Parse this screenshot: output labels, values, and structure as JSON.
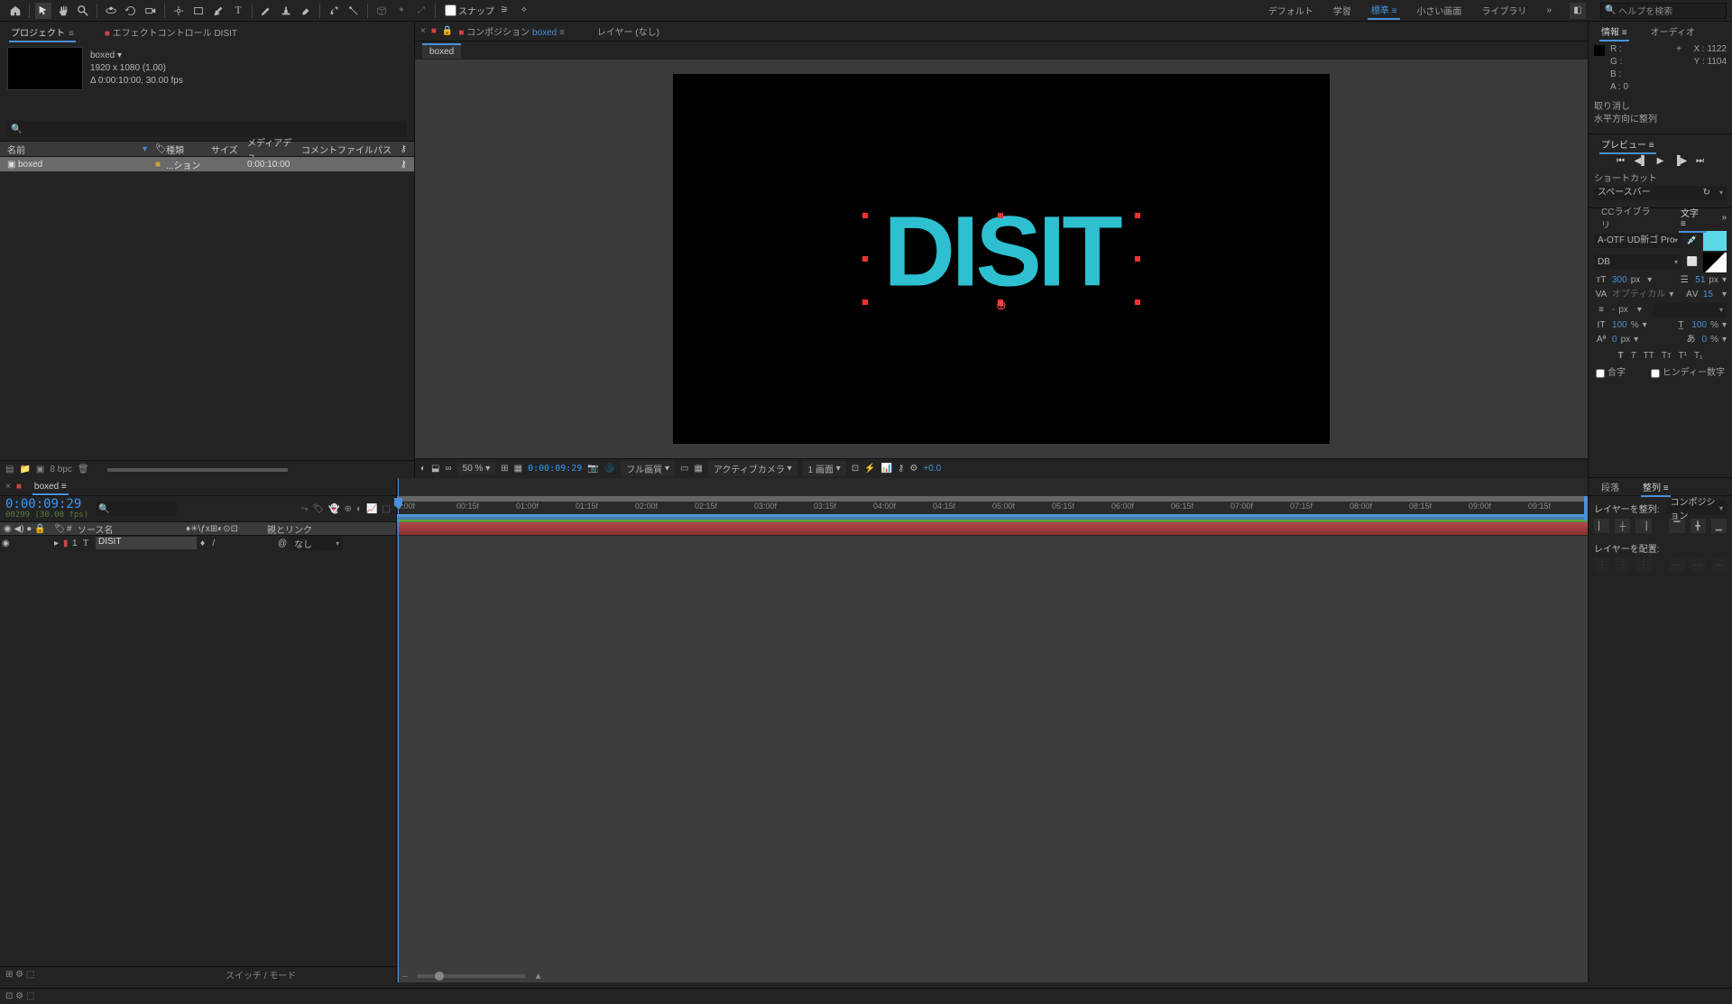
{
  "toolbar": {
    "snap_label": "スナップ",
    "workspace_items": [
      "デフォルト",
      "学習",
      "標準",
      "小さい画面",
      "ライブラリ"
    ],
    "workspace_active": 2,
    "search_placeholder": "ヘルプを検索"
  },
  "project_panel": {
    "tab_project": "プロジェクト",
    "tab_effect": "エフェクトコントロール DISIT",
    "item_name": "boxed",
    "res": "1920 x 1080 (1.00)",
    "dur": "Δ 0:00:10:00, 30.00 fps",
    "cols": {
      "name": "名前",
      "type": "種類",
      "size": "サイズ",
      "media": "メディアデュ..",
      "comment": "コメント",
      "file": "ファイルパス"
    },
    "row": {
      "name": "boxed",
      "type": "...ション",
      "media": "0:00:10:00"
    },
    "bpc": "8 bpc"
  },
  "viewer": {
    "lock": "🔒",
    "comp_label": "コンポジション",
    "comp_name": "boxed",
    "layer_tab": "レイヤー (なし)",
    "subtab": "boxed",
    "text": "DISIT",
    "footer": {
      "zoom": "50 %",
      "tc": "0:00:09:29",
      "quality": "フル画質",
      "camera": "アクティブカメラ",
      "views": "1 画面",
      "exp": "+0.0"
    }
  },
  "info_panel": {
    "tab_info": "情報",
    "tab_audio": "オーディオ",
    "r": "R :",
    "g": "G :",
    "b": "B :",
    "a": "A :  0",
    "x": "X : 1122",
    "y": "Y : 1104",
    "undo": "取り消し",
    "align_msg": "水平方向に整列"
  },
  "preview_panel": {
    "title": "プレビュー",
    "shortcut_lbl": "ショートカット",
    "shortcut": "スペースバー"
  },
  "char_panel": {
    "tab_cc": "CCライブラリ",
    "tab_char": "文字",
    "font": "A-OTF UD新ゴ Pro",
    "weight": "DB",
    "size": "300",
    "size_u": "px",
    "leading": "51",
    "leading_u": "px",
    "kerning": "オプティカル",
    "tracking": "15",
    "dash": "-",
    "dash_u": "px",
    "vscale": "100",
    "vscale_u": "%",
    "hscale": "100",
    "hscale_u": "%",
    "baseline": "0",
    "baseline_u": "px",
    "tsume": "0",
    "tsume_u": "%",
    "ligature": "合字",
    "hindi": "ヒンディー数字"
  },
  "timeline": {
    "tab": "boxed",
    "tc": "0:00:09:29",
    "tc_sub": "00299 (30.00 fps)",
    "hdr_source": "ソース名",
    "hdr_parent": "親とリンク",
    "hdr_switches": "スイッチ / モード",
    "layer": {
      "num": "1",
      "name": "DISIT",
      "parent": "なし"
    },
    "ruler": [
      "0:00f",
      "00:15f",
      "01:00f",
      "01:15f",
      "02:00f",
      "02:15f",
      "03:00f",
      "03:15f",
      "04:00f",
      "04:15f",
      "05:00f",
      "05:15f",
      "06:00f",
      "06:15f",
      "07:00f",
      "07:15f",
      "08:00f",
      "08:15f",
      "09:00f",
      "09:15f"
    ]
  },
  "align_panel": {
    "tab_para": "段落",
    "tab_align": "整列",
    "align_to_lbl": "レイヤーを整列:",
    "align_to": "コンポジション",
    "distribute_lbl": "レイヤーを配置:"
  }
}
